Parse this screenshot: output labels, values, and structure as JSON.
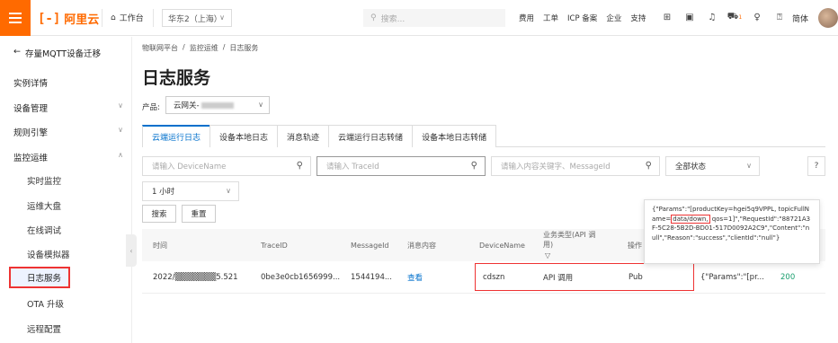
{
  "topbar": {
    "logo_mark": "[-]",
    "logo_text": "阿里云",
    "workbench": "工作台",
    "region": "华东2（上海）",
    "search_placeholder": "搜索...",
    "nav": [
      "费用",
      "工单",
      "ICP 备案",
      "企业",
      "支持"
    ],
    "cart_badge": "1",
    "lang": "简体"
  },
  "sidebar": {
    "back_label": "存量MQTT设备迁移",
    "items": [
      {
        "label": "实例详情"
      },
      {
        "label": "设备管理"
      },
      {
        "label": "规则引擎"
      },
      {
        "label": "监控运维"
      }
    ],
    "sub_items": [
      "实时监控",
      "运维大盘",
      "在线调试",
      "设备模拟器",
      "日志服务",
      "OTA 升级",
      "远程配置"
    ]
  },
  "main": {
    "breadcrumb": [
      "物联网平台",
      "/",
      "监控运维",
      "/",
      "日志服务"
    ],
    "title": "日志服务",
    "product_label": "产品:",
    "product_value": "云网关-",
    "tabs": [
      "云端运行日志",
      "设备本地日志",
      "消息轨迹",
      "云端运行日志转储",
      "设备本地日志转储"
    ],
    "filters": {
      "device_name_placeholder": "请输入 DeviceName",
      "trace_id_placeholder": "请输入 TraceId",
      "message_placeholder": "请输入内容关键字、MessageId",
      "status": "全部状态",
      "time": "1 小时",
      "help": "?"
    },
    "buttons": {
      "search": "搜索",
      "reset": "重置"
    },
    "table": {
      "headers": [
        "时间",
        "TraceID",
        "MessageId",
        "消息内容",
        "DeviceName",
        "业务类型(API 调用)",
        "操作"
      ],
      "rows": [
        {
          "time": "2022/▒▒▒▒▒▒▒5.521",
          "trace_id": "0be3e0cb1656999...",
          "message_id": "1544194...",
          "content": "查看",
          "device_name": "cdszn",
          "biz_type": "API 调用",
          "op": "Pub",
          "params": "{\"Params\":\"[pr...",
          "code": "200"
        }
      ]
    },
    "tooltip": {
      "pre": "{\"Params\":\"[productKey=hgei5q9VPPL, topicFullName=",
      "highlight": "data/down,",
      "post": " qos=1]\",\"RequestId\":\"88721A3F-5C28-5B2D-BD01-517D0092A2C9\",\"Content\":\"null\",\"Reason\":\"success\",\"clientId\":\"null\"}"
    }
  },
  "colors": {
    "brand": "#ff6a00",
    "link": "#0070cc",
    "highlight": "#e33333"
  }
}
